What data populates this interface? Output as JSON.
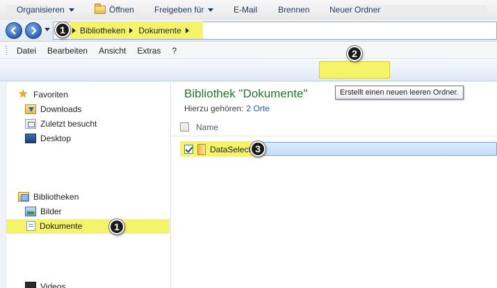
{
  "address_bar": {
    "crumbs": [
      "Bibliotheken",
      "Dokumente"
    ]
  },
  "badges": {
    "addr": "1",
    "new_folder": "2",
    "file": "3",
    "nav": "1"
  },
  "menu": {
    "items": [
      "Datei",
      "Bearbeiten",
      "Ansicht",
      "Extras",
      "?"
    ]
  },
  "toolbar": {
    "organize": "Organisieren",
    "open": "Öffnen",
    "share": "Freigeben für",
    "email": "E-Mail",
    "burn": "Brennen",
    "new_folder": "Neuer Ordner"
  },
  "tooltip": "Erstellt einen neuen leeren Ordner.",
  "nav_pane": {
    "favorites_label": "Favoriten",
    "favorites": [
      "Downloads",
      "Zuletzt besucht",
      "Desktop"
    ],
    "libraries_label": "Bibliotheken",
    "libraries": [
      "Bilder",
      "Dokumente",
      "Videos"
    ]
  },
  "content": {
    "title": "Bibliothek \"Dokumente\"",
    "belongs_label": "Hierzu gehören:",
    "belongs_link": "2 Orte",
    "column_name": "Name",
    "files": [
      {
        "name": "DataSelect",
        "checked": true
      }
    ]
  },
  "colors": {
    "highlight": "#f4f36a",
    "library_title": "#1e7b28",
    "link": "#1d5fb0"
  }
}
